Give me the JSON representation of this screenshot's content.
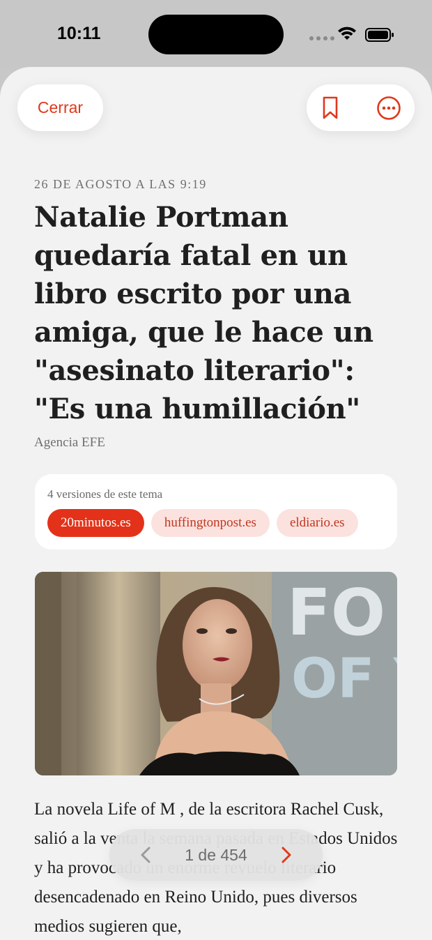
{
  "status_bar": {
    "time": "10:11"
  },
  "toolbar": {
    "close_label": "Cerrar",
    "bookmark_icon": "bookmark-icon",
    "more_icon": "ellipsis-circle-icon",
    "accent_color": "#e0381a"
  },
  "article": {
    "date": "26 DE AGOSTO A LAS 9:19",
    "title": "Natalie Portman quedaría fatal en un libro escrito por una amiga, que le hace un \"asesinato literario\": \"Es una humillación\"",
    "source": "Agencia EFE",
    "body": "La novela Life of M , de la escritora Rachel Cusk, salió a la venta la semana pasada en Estados Unidos y ha provocado un enorme revuelo literario desencadenado en Reino Unido, pues diversos medios sugieren que,"
  },
  "versions": {
    "title": "4 versiones de este tema",
    "chips": [
      {
        "label": "20minutos.es",
        "selected": true
      },
      {
        "label": "huffingtonpost.es",
        "selected": false
      },
      {
        "label": "eldiario.es",
        "selected": false
      }
    ]
  },
  "pager": {
    "label": "1 de 454",
    "prev_icon": "chevron-left-icon",
    "next_icon": "chevron-right-icon"
  }
}
